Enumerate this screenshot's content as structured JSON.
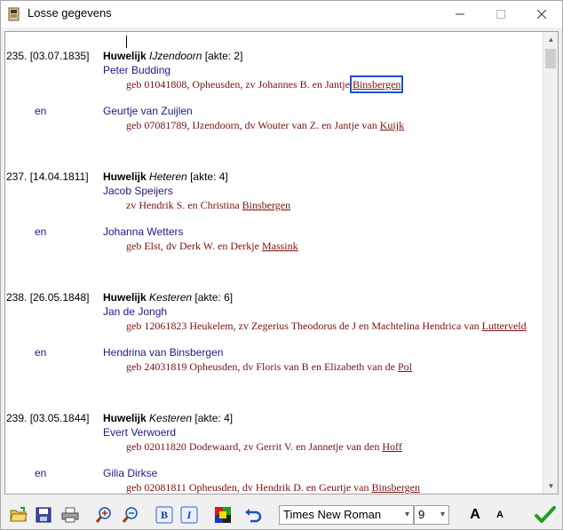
{
  "window": {
    "title": "Losse gegevens",
    "minimize": "—",
    "maximize": "☐",
    "close": "✕"
  },
  "records": [
    {
      "num": "235. [03.07.1835]",
      "type": "Huwelijk",
      "place": "IJzendoorn",
      "akte": "[akte: 2]",
      "person1": "Peter Budding",
      "detail1_text": "geb 01041808, Opheusden, zv Johannes B. en Jantje ",
      "detail1_link": "Binsbergen",
      "en": "en",
      "person2": "Geurtje van Zuijlen",
      "detail2_text": "geb 07081789, IJzendoorn, dv Wouter van Z. en Jantje van ",
      "detail2_link": "Kuijk"
    },
    {
      "num": "237. [14.04.1811]",
      "type": "Huwelijk",
      "place": "Heteren",
      "akte": "[akte: 4]",
      "person1": "Jacob Speijers",
      "detail1_text": "zv Hendrik S. en Christina ",
      "detail1_link": "Binsbergen",
      "en": "en",
      "person2": "Johanna Wetters",
      "detail2_text": "geb Elst, dv Derk W. en Derkje ",
      "detail2_link": "Massink"
    },
    {
      "num": "238. [26.05.1848]",
      "type": "Huwelijk",
      "place": "Kesteren",
      "akte": "[akte: 6]",
      "person1": "Jan de Jongh",
      "detail1_text": "geb 12061823 Heukelem, zv Zegerius Theodorus de J en Machtelina Hendrica van ",
      "detail1_link": "Lutterveld",
      "en": "en",
      "person2": "Hendrina van Binsbergen",
      "detail2_text": "geb 24031819 Opheusden, dv Floris van B en Elizabeth van de ",
      "detail2_link": "Pol"
    },
    {
      "num": "239. [03.05.1844]",
      "type": "Huwelijk",
      "place": "Kesteren",
      "akte": "[akte: 4]",
      "person1": "Evert Verwoerd",
      "detail1_text": "geb 02011820 Dodewaard, zv Gerrit V. en Jannetje van den ",
      "detail1_link": "Hoff",
      "en": "en",
      "person2": "Gilia Dirkse",
      "detail2_text": "geb 02081811 Opheusden, dv Hendrik D. en Geurtje van ",
      "detail2_link": "Binsbergen"
    }
  ],
  "toolbar": {
    "font_name": "Times New Roman",
    "font_size": "9",
    "bold_label": "B",
    "italic_label": "I",
    "font_bigger": "A",
    "font_smaller": "A"
  },
  "colors": {
    "person": "#1a1a8c",
    "detail": "#7a1010",
    "highlight": "#1d4fd8",
    "ok": "#1ea01e"
  }
}
